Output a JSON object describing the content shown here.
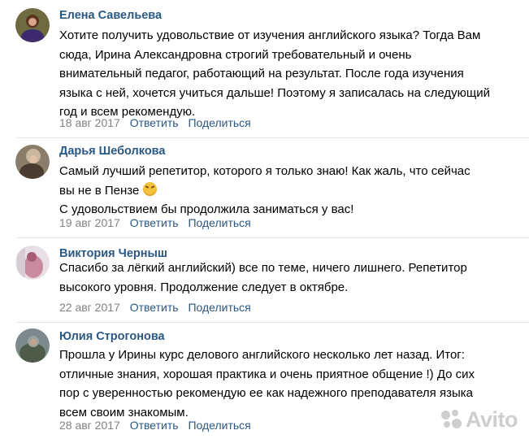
{
  "comments": [
    {
      "author": "Елена Савельева",
      "lines": [
        "Хотите получить удовольствие от изучения английского языка? Тогда Вам",
        "сюда, Ирина Александровна строгий требовательный и очень",
        "внимательный педагог, работающий на результат. После года изучения",
        "языка с ней, хочется учиться дальше! Поэтому я записалась на следующий",
        "год и всем рекомендую."
      ],
      "date": "18 авг 2017",
      "reply": "Ответить",
      "share": "Поделиться"
    },
    {
      "author": "Дарья Шеболкова",
      "lines": [
        "Самый лучший репетитор, которого я только знаю! Как жаль, что сейчас",
        "вы не в Пензе",
        "С удовольствием бы продолжила заниматься у вас!"
      ],
      "date": "19 авг 2017",
      "reply": "Ответить",
      "share": "Поделиться"
    },
    {
      "author": "Виктория Черныш",
      "lines": [
        "Спасибо за лёгкий английский) все по теме, ничего лишнего. Репетитор",
        "высокого уровня. Продолжение следует в октябре."
      ],
      "date": "22 авг 2017",
      "reply": "Ответить",
      "share": "Поделиться"
    },
    {
      "author": "Юлия Строгонова",
      "lines": [
        "Прошла у Ирины курс делового английского несколько лет назад. Итог:",
        "отличные знания, хорошая практика и очень приятное общение !) До сих",
        "пор с уверенностью рекомендую ее как надежного преподавателя языка",
        "всем своим знакомым."
      ],
      "date": "28 авг 2017",
      "reply": "Ответить",
      "share": "Поделиться"
    }
  ],
  "watermark": "Avito",
  "colors": {
    "author": "#2a5885",
    "action": "#2a5885",
    "date": "#828282",
    "divider": "#e3e6ea"
  }
}
